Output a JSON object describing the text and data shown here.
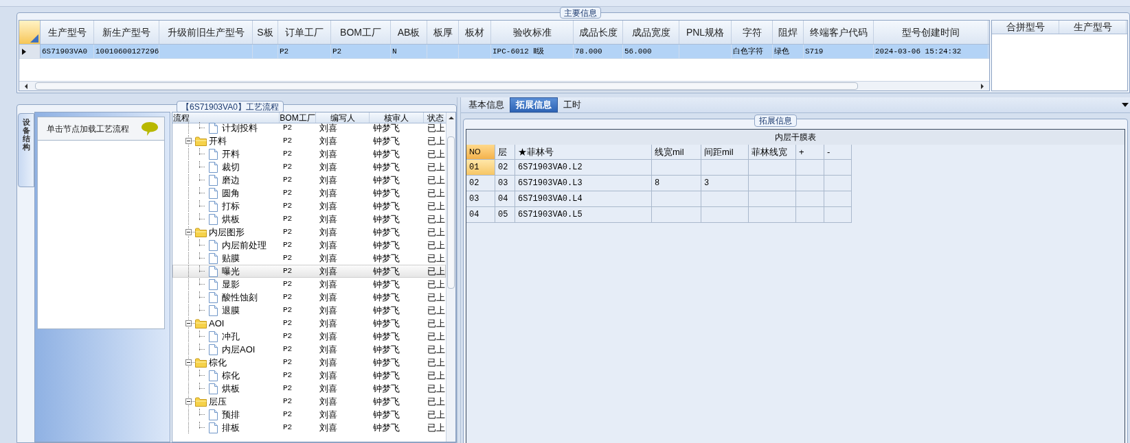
{
  "main_info": {
    "title": "主要信息",
    "columns": [
      "生产型号",
      "新生产型号",
      "升级前旧生产型号",
      "S板",
      "订单工厂",
      "BOM工厂",
      "AB板",
      "板厚",
      "板材",
      "验收标准",
      "成品长度",
      "成品宽度",
      "PNL规格",
      "字符",
      "阻焊",
      "终端客户代码",
      "型号创建时间"
    ],
    "rows": [
      {
        "selected": true,
        "cells": [
          "6S71903VA0",
          "10010600127296",
          null,
          null,
          "P2",
          "P2",
          "N",
          null,
          null,
          "IPC-6012 Ⅱ级",
          "78.000",
          "56.000",
          null,
          "白色字符",
          "绿色",
          "S719",
          "2024-03-06 15:24:32"
        ]
      }
    ],
    "side_columns": [
      "合拼型号",
      "生产型号"
    ]
  },
  "flow_panel": {
    "title": "【6S71903VA0】工艺流程",
    "side_tab": "设备结构",
    "hint": "单击节点加载工艺流程",
    "columns": [
      "流程",
      "BOM工厂",
      "编写人",
      "核审人",
      "状态"
    ],
    "rows": [
      {
        "kind": "step",
        "label": "计划投料",
        "bom": "P2",
        "writer": "刘喜",
        "reviewer": "钟梦飞",
        "status": "已上",
        "selected": false
      },
      {
        "kind": "stage",
        "label": "开料",
        "bom": "P2",
        "writer": "刘喜",
        "reviewer": "钟梦飞",
        "status": "已上",
        "selected": false,
        "expanded": true,
        "children": [
          {
            "kind": "step",
            "label": "开料",
            "bom": "P2",
            "writer": "刘喜",
            "reviewer": "钟梦飞",
            "status": "已上",
            "selected": false
          },
          {
            "kind": "step",
            "label": "裁切",
            "bom": "P2",
            "writer": "刘喜",
            "reviewer": "钟梦飞",
            "status": "已上",
            "selected": false
          },
          {
            "kind": "step",
            "label": "磨边",
            "bom": "P2",
            "writer": "刘喜",
            "reviewer": "钟梦飞",
            "status": "已上",
            "selected": false
          },
          {
            "kind": "step",
            "label": "圆角",
            "bom": "P2",
            "writer": "刘喜",
            "reviewer": "钟梦飞",
            "status": "已上",
            "selected": false
          },
          {
            "kind": "step",
            "label": "打标",
            "bom": "P2",
            "writer": "刘喜",
            "reviewer": "钟梦飞",
            "status": "已上",
            "selected": false
          },
          {
            "kind": "step",
            "label": "烘板",
            "bom": "P2",
            "writer": "刘喜",
            "reviewer": "钟梦飞",
            "status": "已上",
            "selected": false
          }
        ]
      },
      {
        "kind": "stage",
        "label": "内层图形",
        "bom": "P2",
        "writer": "刘喜",
        "reviewer": "钟梦飞",
        "status": "已上",
        "selected": false,
        "expanded": true,
        "children": [
          {
            "kind": "step",
            "label": "内层前处理",
            "bom": "P2",
            "writer": "刘喜",
            "reviewer": "钟梦飞",
            "status": "已上",
            "selected": false
          },
          {
            "kind": "step",
            "label": "贴膜",
            "bom": "P2",
            "writer": "刘喜",
            "reviewer": "钟梦飞",
            "status": "已上",
            "selected": false
          },
          {
            "kind": "step",
            "label": "曝光",
            "bom": "P2",
            "writer": "刘喜",
            "reviewer": "钟梦飞",
            "status": "已上",
            "selected": true
          },
          {
            "kind": "step",
            "label": "显影",
            "bom": "P2",
            "writer": "刘喜",
            "reviewer": "钟梦飞",
            "status": "已上",
            "selected": false
          },
          {
            "kind": "step",
            "label": "酸性蚀刻",
            "bom": "P2",
            "writer": "刘喜",
            "reviewer": "钟梦飞",
            "status": "已上",
            "selected": false
          },
          {
            "kind": "step",
            "label": "退膜",
            "bom": "P2",
            "writer": "刘喜",
            "reviewer": "钟梦飞",
            "status": "已上",
            "selected": false
          }
        ]
      },
      {
        "kind": "stage",
        "label": "AOI",
        "bom": "P2",
        "writer": "刘喜",
        "reviewer": "钟梦飞",
        "status": "已上",
        "selected": false,
        "expanded": true,
        "children": [
          {
            "kind": "step",
            "label": "冲孔",
            "bom": "P2",
            "writer": "刘喜",
            "reviewer": "钟梦飞",
            "status": "已上",
            "selected": false
          },
          {
            "kind": "step",
            "label": "内层AOI",
            "bom": "P2",
            "writer": "刘喜",
            "reviewer": "钟梦飞",
            "status": "已上",
            "selected": false
          }
        ]
      },
      {
        "kind": "stage",
        "label": "棕化",
        "bom": "P2",
        "writer": "刘喜",
        "reviewer": "钟梦飞",
        "status": "已上",
        "selected": false,
        "expanded": true,
        "children": [
          {
            "kind": "step",
            "label": "棕化",
            "bom": "P2",
            "writer": "刘喜",
            "reviewer": "钟梦飞",
            "status": "已上",
            "selected": false
          },
          {
            "kind": "step",
            "label": "烘板",
            "bom": "P2",
            "writer": "刘喜",
            "reviewer": "钟梦飞",
            "status": "已上",
            "selected": false
          }
        ]
      },
      {
        "kind": "stage",
        "label": "层压",
        "bom": "P2",
        "writer": "刘喜",
        "reviewer": "钟梦飞",
        "status": "已上",
        "selected": false,
        "expanded": true,
        "children": [
          {
            "kind": "step",
            "label": "预排",
            "bom": "P2",
            "writer": "刘喜",
            "reviewer": "钟梦飞",
            "status": "已上",
            "selected": false
          },
          {
            "kind": "step",
            "label": "排板",
            "bom": "P2",
            "writer": "刘喜",
            "reviewer": "钟梦飞",
            "status": "已上",
            "selected": false
          }
        ]
      }
    ]
  },
  "detail": {
    "tabs": [
      {
        "label": "基本信息",
        "selected": false
      },
      {
        "label": "拓展信息",
        "selected": true
      },
      {
        "label": "工时",
        "selected": false
      }
    ],
    "group_title": "拓展信息",
    "table": {
      "title": "内层干膜表",
      "columns": [
        "NO",
        "层",
        "★菲林号",
        "线宽mil",
        "间距mil",
        "菲林线宽",
        "+",
        "-"
      ],
      "rows": [
        {
          "selected": true,
          "cells": [
            "01",
            "02",
            "6S71903VA0.L2",
            null,
            null,
            null,
            null,
            null
          ]
        },
        {
          "selected": false,
          "cells": [
            "02",
            "03",
            "6S71903VA0.L3",
            "8",
            "3",
            null,
            null,
            null
          ]
        },
        {
          "selected": false,
          "cells": [
            "03",
            "04",
            "6S71903VA0.L4",
            null,
            null,
            null,
            null,
            null
          ]
        },
        {
          "selected": false,
          "cells": [
            "04",
            "05",
            "6S71903VA0.L5",
            null,
            null,
            null,
            null,
            null
          ]
        }
      ]
    }
  }
}
